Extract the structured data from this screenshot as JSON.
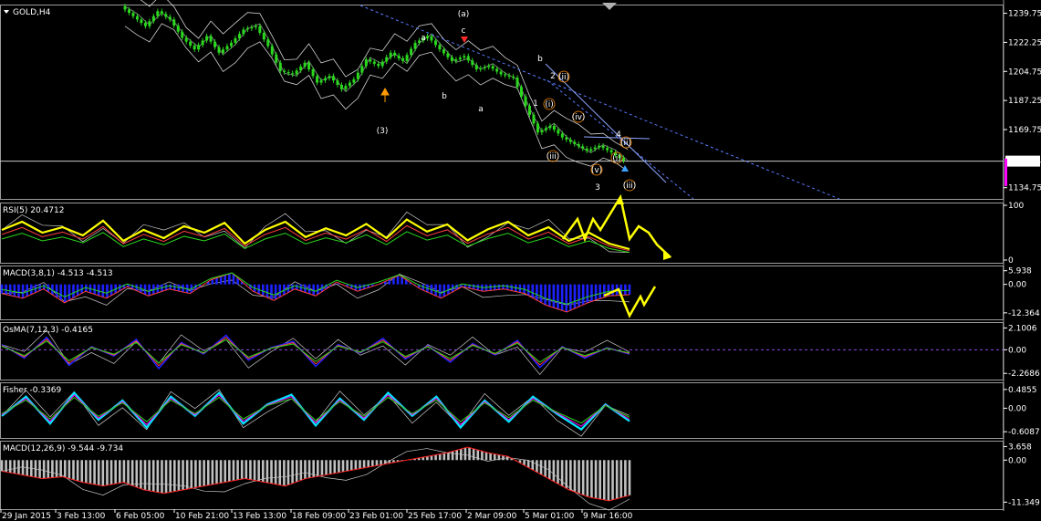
{
  "chart_data": {
    "type": "line",
    "symbol": "GOLD,H4",
    "x_ticks": [
      "29 Jan 2015",
      "3 Feb 13:00",
      "6 Feb 05:00",
      "10 Feb 21:00",
      "13 Feb 13:00",
      "18 Feb 09:00",
      "23 Feb 01:00",
      "25 Feb 17:00",
      "2 Mar 09:00",
      "5 Mar 01:00",
      "9 Mar 16:00"
    ],
    "price_ticks": [
      "1239.75",
      "1222.25",
      "1204.75",
      "1187.25",
      "1169.75",
      "1134.75"
    ],
    "price_ylim": [
      1128,
      1245
    ],
    "current_price": "1150.74",
    "price_close": [
      1244,
      1238,
      1232,
      1241,
      1236,
      1225,
      1218,
      1226,
      1216,
      1222,
      1230,
      1232,
      1220,
      1205,
      1203,
      1210,
      1198,
      1202,
      1194,
      1200,
      1212,
      1208,
      1216,
      1211,
      1222,
      1226,
      1218,
      1211,
      1214,
      1206,
      1208,
      1203,
      1201,
      1184,
      1168,
      1172,
      1165,
      1161,
      1157,
      1160,
      1156,
      1151
    ],
    "wave_labels": [
      {
        "text": "(a)",
        "color": "#1e90ff"
      },
      {
        "text": "a",
        "color": "#9acd32"
      },
      {
        "text": "c",
        "color": "#9acd32"
      },
      {
        "text": "b",
        "color": "#9acd32"
      },
      {
        "text": "b",
        "color": "#9acd32"
      },
      {
        "text": "a",
        "color": "#9acd32"
      },
      {
        "text": "(3)",
        "color": "#ffd700"
      },
      {
        "text": "1",
        "color": "#ff2a2a"
      },
      {
        "text": "2",
        "color": "#ff2a2a"
      },
      {
        "text": "3",
        "color": "#ff2a2a"
      },
      {
        "text": "4",
        "color": "#ff2a2a"
      },
      {
        "text": "(i)",
        "color": "#ff8c00"
      },
      {
        "text": "(ii)",
        "color": "#ff8c00"
      },
      {
        "text": "(iii)",
        "color": "#ff8c00"
      },
      {
        "text": "(iv)",
        "color": "#ff8c00"
      },
      {
        "text": "(v)",
        "color": "#ff8c00"
      },
      {
        "text": "(i)",
        "color": "#ff8c00"
      },
      {
        "text": "(ii)",
        "color": "#ff8c00"
      },
      {
        "text": "(iii)",
        "color": "#ff8c00"
      }
    ],
    "indicators": [
      {
        "title": "RSI(5) 20.4712",
        "ticks": [
          "100",
          "0"
        ],
        "ylim": [
          0,
          100
        ],
        "main_color": "#ffff00",
        "values": [
          55,
          70,
          50,
          60,
          45,
          72,
          35,
          55,
          40,
          62,
          50,
          68,
          30,
          55,
          70,
          42,
          58,
          45,
          66,
          40,
          74,
          52,
          65,
          36,
          56,
          70,
          45,
          60,
          35,
          50,
          30,
          20
        ]
      },
      {
        "title": "MACD(3,8,1) -4.513 -4.513",
        "ticks": [
          "5.938",
          "0.00",
          "-12.364"
        ],
        "ylim": [
          -14,
          7
        ],
        "main_color": "#1e22ff",
        "values": [
          -4,
          -6,
          -2,
          -8,
          -3,
          -6,
          -1,
          -5,
          -2,
          -4,
          2,
          5,
          -3,
          -7,
          -2,
          -5,
          1,
          -3,
          0,
          4,
          -2,
          -6,
          -1,
          -3,
          -2,
          -4,
          -9,
          -12,
          -8,
          -5,
          -4.5
        ]
      },
      {
        "title": "OsMA(7,12,3) -0.4165",
        "ticks": [
          "2.1006",
          "0.00",
          "-2.2686"
        ],
        "ylim": [
          -2.6,
          2.4
        ],
        "main_color": "#1e22ff",
        "values": [
          0.5,
          -0.8,
          1.2,
          -1.5,
          0.3,
          -0.6,
          1.0,
          -1.8,
          0.7,
          -0.4,
          1.4,
          -1.0,
          0.2,
          0.8,
          -1.6,
          0.5,
          -0.3,
          1.1,
          -0.9,
          0.4,
          -1.2,
          0.6,
          -0.5,
          0.9,
          -1.7,
          0.3,
          -0.8,
          0.2,
          -0.4165
        ]
      },
      {
        "title": "Fisher -0.3369",
        "ticks": [
          "0.4855",
          "0.00",
          "-0.6087"
        ],
        "ylim": [
          -0.7,
          0.6
        ],
        "main_color": "#00e5ff",
        "values": [
          -0.2,
          0.3,
          -0.4,
          0.4,
          -0.3,
          0.2,
          -0.5,
          0.3,
          -0.2,
          0.4,
          -0.4,
          0.1,
          0.35,
          -0.45,
          0.25,
          -0.3,
          0.4,
          -0.2,
          0.3,
          -0.5,
          0.2,
          -0.35,
          0.3,
          -0.15,
          -0.55,
          0.1,
          -0.3369
        ]
      },
      {
        "title": "MACD(12,26,9) -9.544 -9.734",
        "ticks": [
          "3.658",
          "0.00",
          "-11.349"
        ],
        "ylim": [
          -12.5,
          4.5
        ],
        "main_color": "#c0c0c0",
        "values": [
          -3,
          -4,
          -5,
          -4.5,
          -6,
          -7,
          -6,
          -8,
          -9,
          -8,
          -7,
          -6,
          -5,
          -6,
          -7,
          -5,
          -4,
          -3,
          -2,
          -1,
          0,
          1,
          2,
          3.5,
          2,
          1,
          -2,
          -5,
          -8,
          -10,
          -11,
          -9.5
        ]
      }
    ]
  }
}
